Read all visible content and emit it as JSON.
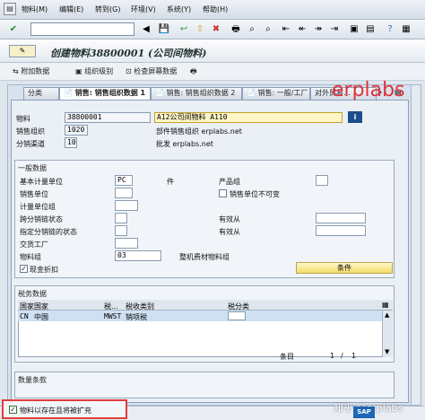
{
  "menu": {
    "items": [
      "物料(M)",
      "编辑(E)",
      "转到(G)",
      "环境(V)",
      "系统(Y)",
      "帮助(H)"
    ]
  },
  "title": "创建物料38800001 (公司间物料)",
  "appbar": {
    "buttons": [
      "附加数据",
      "组织级别",
      "检查屏幕数据"
    ]
  },
  "tabs": [
    "分类",
    "销售: 销售组织数据 1",
    "销售: 销售组织数据 2",
    "销售: 一般/工厂",
    "对外贸易..."
  ],
  "header": {
    "material_label": "物料",
    "material_value": "38800001",
    "material_desc": "A12公司间物料 A110",
    "sales_org_label": "销售组织",
    "sales_org_value": "1020",
    "sales_org_desc": "部件销售组织 erplabs.net",
    "dist_channel_label": "分销渠道",
    "dist_channel_value": "10",
    "dist_channel_desc": "批发 erplabs.net"
  },
  "general": {
    "section_title": "一般数据",
    "base_uom_label": "基本计量单位",
    "base_uom_value": "PC",
    "base_uom_unit": "件",
    "sales_unit_label": "销售单位",
    "uom_group_label": "计量单位组",
    "xdist_status_label": "跨分销链状态",
    "dist_status_label": "指定分销链的状态",
    "delivering_plant_label": "交货工厂",
    "material_group_label": "物料组",
    "material_group_value": "03",
    "material_group_desc": "整机费材物料组",
    "cash_discount_label": "现金折扣",
    "division_label": "产品组",
    "sales_unit_not_var_label": "销售单位不可变",
    "valid_from_label_1": "有效从",
    "valid_from_label_2": "有效从",
    "conditions_button": "条件"
  },
  "tax": {
    "section_title": "税务数据",
    "columns": [
      "国家",
      "国家",
      "税...",
      "税收类别",
      "税分类"
    ],
    "rows": [
      {
        "country": "CN",
        "country_name": "中国",
        "tax_cat": "MWST",
        "tax_cat_desc": "销项税"
      }
    ],
    "entry_label": "条目",
    "entry_current": "1",
    "entry_sep": "/",
    "entry_total": "1"
  },
  "quantity": {
    "section_title": "数量条款"
  },
  "footer": {
    "checkbox_label": "物料以存在且将被扩充"
  },
  "watermarks": {
    "erplabs": "erplabs",
    "zhihu": "知乎 @erplabs",
    "sap": "SAP"
  }
}
